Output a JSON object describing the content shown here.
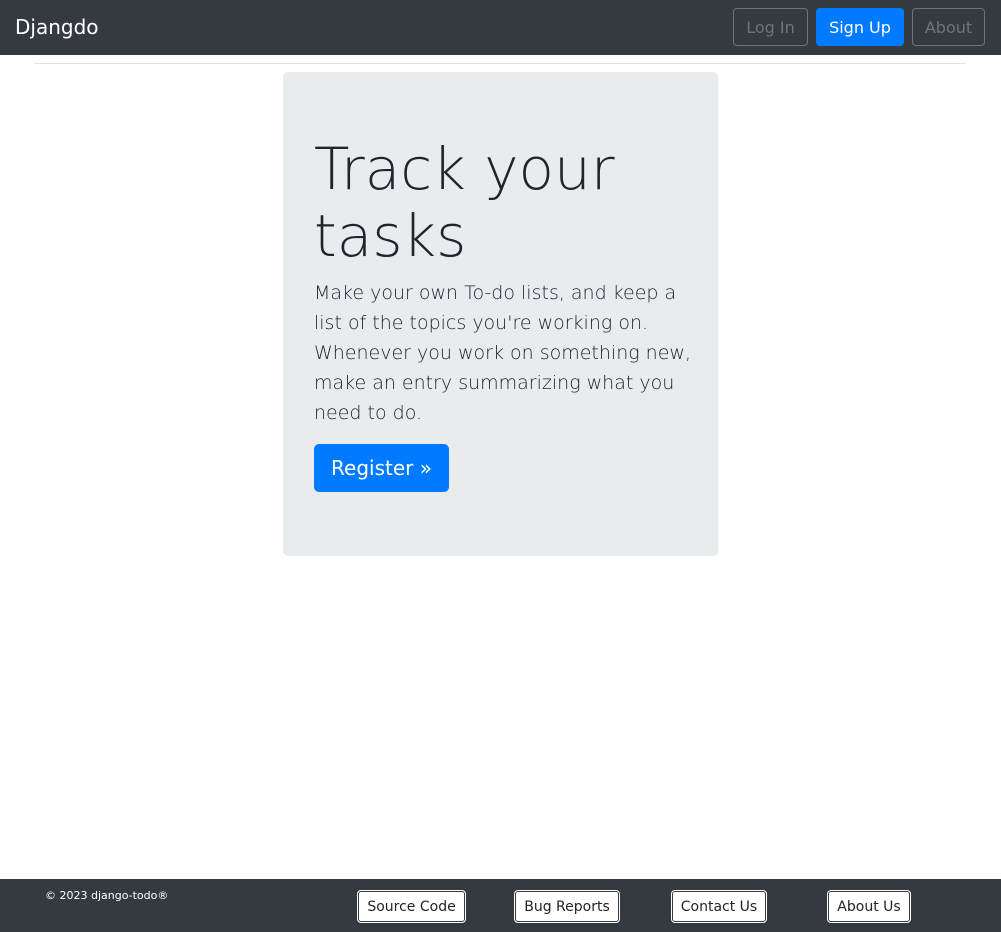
{
  "navbar": {
    "brand": "Djangdo",
    "login_label": "Log In",
    "signup_label": "Sign Up",
    "about_label": "About"
  },
  "hero": {
    "title": "Track your tasks",
    "lead": "Make your own To-do lists, and keep a list of the topics you're working on. Whenever you work on something new, make an entry summarizing what you need to do.",
    "register_label": "Register »"
  },
  "footer": {
    "copyright": "© 2023 django-todo®",
    "links": {
      "source_code": "Source Code",
      "bug_reports": "Bug Reports",
      "contact_us": "Contact Us",
      "about_us": "About Us"
    }
  },
  "colors": {
    "navbar_bg": "#343a40",
    "primary": "#007bff",
    "secondary": "#6c757d",
    "jumbotron_bg": "#e9ecef"
  }
}
